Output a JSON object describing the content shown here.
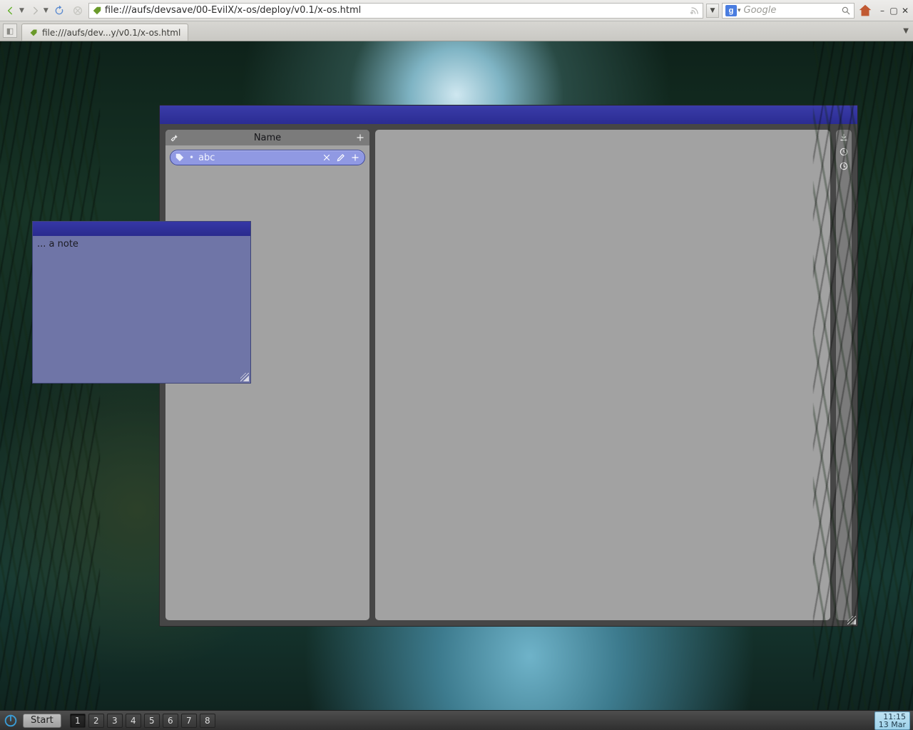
{
  "browser": {
    "url": "file:///aufs/devsave/00-EvilX/x-os/deploy/v0.1/x-os.html",
    "search_placeholder": "Google",
    "tab_label": "file:///aufs/dev...y/v0.1/x-os.html"
  },
  "app": {
    "left_pane": {
      "header_title": "Name",
      "items": [
        {
          "text": "abc"
        }
      ]
    }
  },
  "note": {
    "text": "... a note"
  },
  "taskbar": {
    "start_label": "Start",
    "workspaces": [
      "1",
      "2",
      "3",
      "4",
      "5",
      "6",
      "7",
      "8"
    ],
    "active_workspace": 0,
    "clock_time": "11:15",
    "clock_date": "13 Mar"
  }
}
